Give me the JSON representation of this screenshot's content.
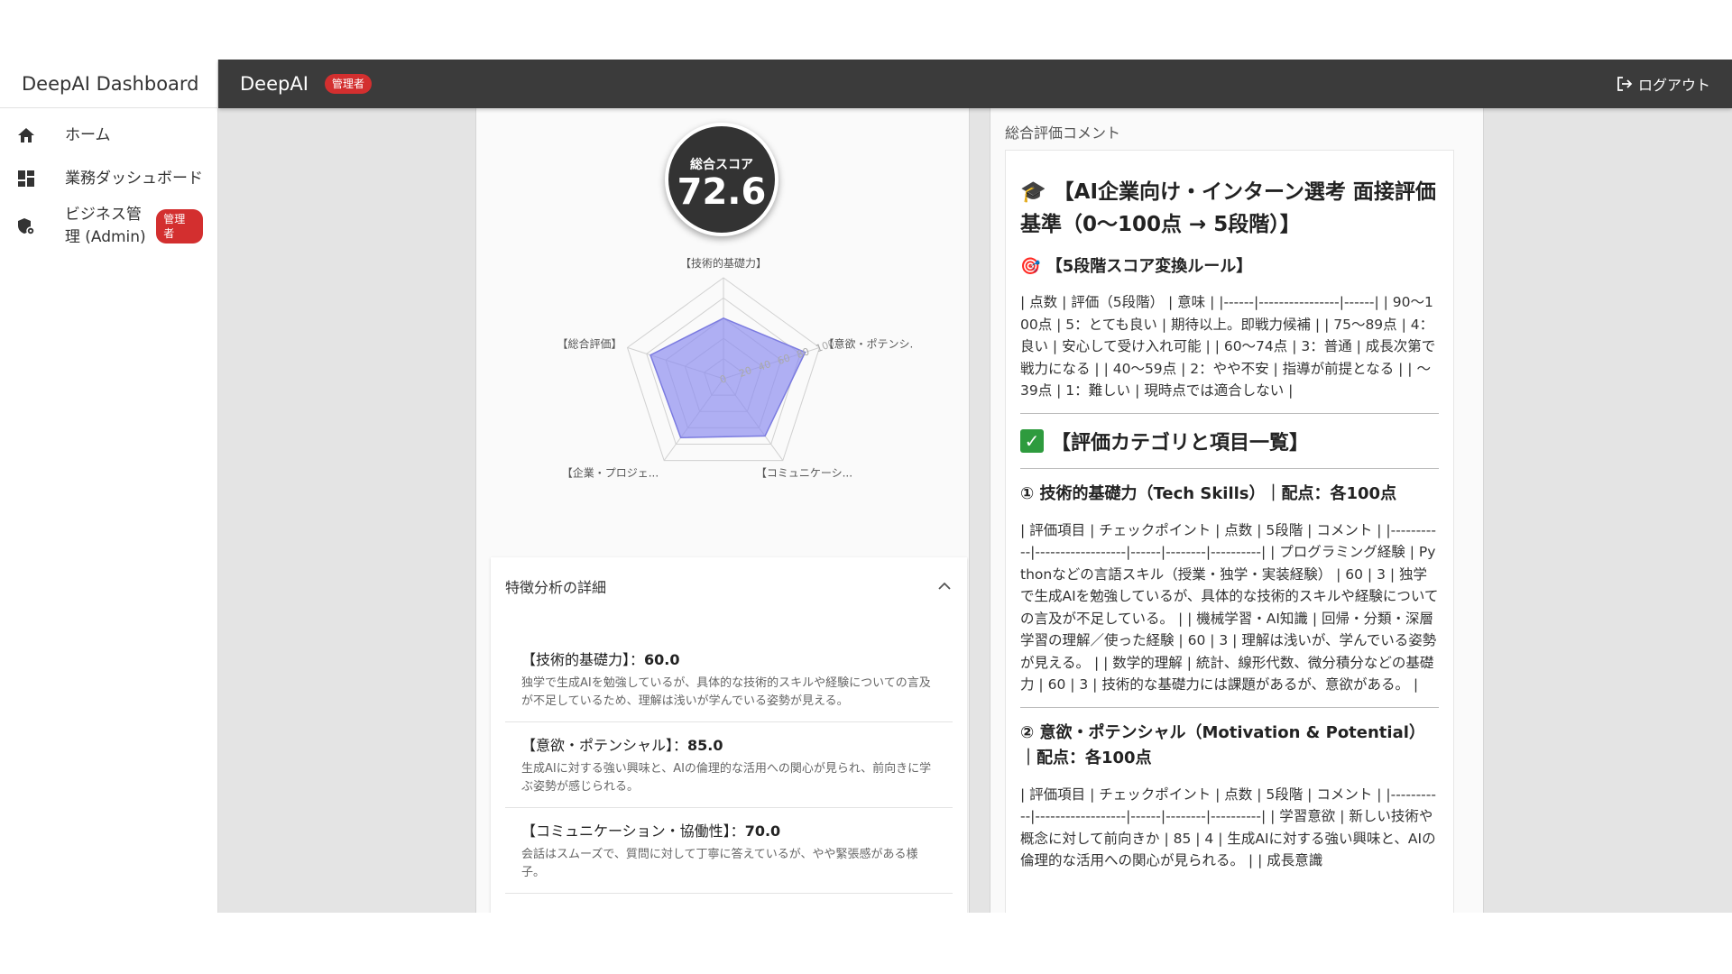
{
  "sidebar": {
    "brand": "DeepAI Dashboard",
    "items": [
      {
        "label": "ホーム",
        "icon": "home-icon"
      },
      {
        "label": "業務ダッシュボード",
        "icon": "dashboard-grid-icon"
      },
      {
        "label": "ビジネス管理 (Admin)",
        "icon": "shield-gear-icon",
        "badge": "管理者"
      }
    ]
  },
  "topbar": {
    "title": "DeepAI",
    "badge": "管理者",
    "logout_label": "ログアウト"
  },
  "score": {
    "label": "総合スコア",
    "value": "72.6"
  },
  "radar": {
    "axes": [
      "【技術的基礎力】",
      "【意欲・ポテンシ...",
      "【コミュニケーシ...",
      "【企業・プロジェ...",
      "【総合評価】"
    ],
    "values": [
      60,
      85,
      70,
      72,
      76
    ],
    "max": 100,
    "ring_labels": [
      "0",
      "20",
      "40",
      "60",
      "80",
      "100"
    ],
    "fill_color": "#8f8ff0"
  },
  "details": {
    "header": "特徴分析の詳細",
    "items": [
      {
        "name": "【技術的基礎力】：",
        "score": "60.0",
        "desc": "独学で生成AIを勉強しているが、具体的な技術的スキルや経験についての言及が不足しているため、理解は浅いが学んでいる姿勢が見える。"
      },
      {
        "name": "【意欲・ポテンシャル】：",
        "score": "85.0",
        "desc": "生成AIに対する強い興味と、AIの倫理的な活用への関心が見られ、前向きに学ぶ姿勢が感じられる。"
      },
      {
        "name": "【コミュニケーション・協働性】：",
        "score": "70.0",
        "desc": "会話はスムーズで、質問に対して丁寧に答えているが、やや緊張感がある様子。"
      }
    ]
  },
  "comment": {
    "section_title": "総合評価コメント",
    "h1_icon": "🎓",
    "h1": "【AI企業向け・インターン選考 面接評価基準（0〜100点 → 5段階）】",
    "h3_icon": "🎯",
    "h3": "【5段階スコア変換ルール】",
    "para1": "| 点数 | 評価（5段階） | 意味 | |------|----------------|------| | 90〜100点 | 5：とても良い | 期待以上。即戦力候補 | | 75〜89点 | 4：良い | 安心して受け入れ可能 | | 60〜74点 | 3：普通 | 成長次第で戦力になる | | 40〜59点 | 2：やや不安 | 指導が前提となる | | 〜39点 | 1：難しい | 現時点では適合しない |",
    "h2": "【評価カテゴリと項目一覧】",
    "h4a": "① 技術的基礎力（Tech Skills）｜配点：各100点",
    "para2": "| 評価項目 | チェックポイント | 点数 | 5段階 | コメント | |-----------|------------------|------|--------|----------| | プログラミング経験 | Pythonなどの言語スキル（授業・独学・実装経験） | 60 | 3 | 独学で生成AIを勉強しているが、具体的な技術的スキルや経験についての言及が不足している。 | | 機械学習・AI知識 | 回帰・分類・深層学習の理解／使った経験 | 60 | 3 | 理解は浅いが、学んでいる姿勢が見える。 | | 数学的理解 | 統計、線形代数、微分積分などの基礎力 | 60 | 3 | 技術的な基礎力には課題があるが、意欲がある。 |",
    "h4b": "② 意欲・ポテンシャル（Motivation & Potential）｜配点：各100点",
    "para3": "| 評価項目 | チェックポイント | 点数 | 5段階 | コメント | |-----------|------------------|------|--------|----------| | 学習意欲 | 新しい技術や概念に対して前向きか | 85 | 4 | 生成AIに対する強い興味と、AIの倫理的な活用への関心が見られる。 | | 成長意識"
  }
}
